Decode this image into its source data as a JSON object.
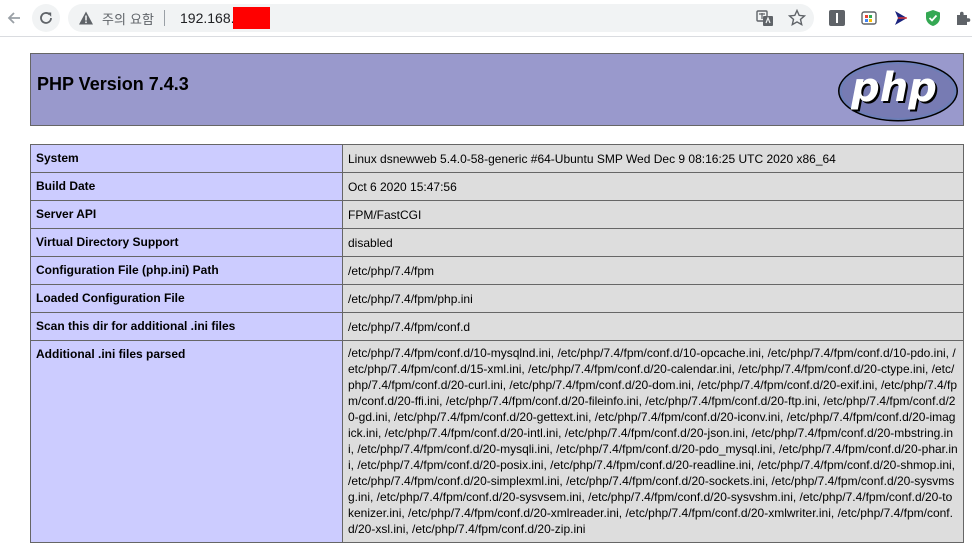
{
  "browser": {
    "security_label": "주의 요함",
    "url_text": "192.168.",
    "icons": [
      "back-arrow-icon",
      "reload-icon",
      "warning-triangle-icon",
      "translate-icon",
      "star-icon",
      "extension-icons",
      "puzzle-icon"
    ]
  },
  "page": {
    "title": "PHP Version 7.4.3",
    "logo_text": "php",
    "rows": [
      {
        "key": "System",
        "value": "Linux dsnewweb 5.4.0-58-generic #64-Ubuntu SMP Wed Dec 9 08:16:25 UTC 2020 x86_64"
      },
      {
        "key": "Build Date",
        "value": "Oct 6 2020 15:47:56"
      },
      {
        "key": "Server API",
        "value": "FPM/FastCGI"
      },
      {
        "key": "Virtual Directory Support",
        "value": "disabled"
      },
      {
        "key": "Configuration File (php.ini) Path",
        "value": "/etc/php/7.4/fpm"
      },
      {
        "key": "Loaded Configuration File",
        "value": "/etc/php/7.4/fpm/php.ini"
      },
      {
        "key": "Scan this dir for additional .ini files",
        "value": "/etc/php/7.4/fpm/conf.d"
      },
      {
        "key": "Additional .ini files parsed",
        "value": "/etc/php/7.4/fpm/conf.d/10-mysqlnd.ini, /etc/php/7.4/fpm/conf.d/10-opcache.ini, /etc/php/7.4/fpm/conf.d/10-pdo.ini, /etc/php/7.4/fpm/conf.d/15-xml.ini, /etc/php/7.4/fpm/conf.d/20-calendar.ini, /etc/php/7.4/fpm/conf.d/20-ctype.ini, /etc/php/7.4/fpm/conf.d/20-curl.ini, /etc/php/7.4/fpm/conf.d/20-dom.ini, /etc/php/7.4/fpm/conf.d/20-exif.ini, /etc/php/7.4/fpm/conf.d/20-ffi.ini, /etc/php/7.4/fpm/conf.d/20-fileinfo.ini, /etc/php/7.4/fpm/conf.d/20-ftp.ini, /etc/php/7.4/fpm/conf.d/20-gd.ini, /etc/php/7.4/fpm/conf.d/20-gettext.ini, /etc/php/7.4/fpm/conf.d/20-iconv.ini, /etc/php/7.4/fpm/conf.d/20-imagick.ini, /etc/php/7.4/fpm/conf.d/20-intl.ini, /etc/php/7.4/fpm/conf.d/20-json.ini, /etc/php/7.4/fpm/conf.d/20-mbstring.ini, /etc/php/7.4/fpm/conf.d/20-mysqli.ini, /etc/php/7.4/fpm/conf.d/20-pdo_mysql.ini, /etc/php/7.4/fpm/conf.d/20-phar.ini, /etc/php/7.4/fpm/conf.d/20-posix.ini, /etc/php/7.4/fpm/conf.d/20-readline.ini, /etc/php/7.4/fpm/conf.d/20-shmop.ini, /etc/php/7.4/fpm/conf.d/20-simplexml.ini, /etc/php/7.4/fpm/conf.d/20-sockets.ini, /etc/php/7.4/fpm/conf.d/20-sysvmsg.ini, /etc/php/7.4/fpm/conf.d/20-sysvsem.ini, /etc/php/7.4/fpm/conf.d/20-sysvshm.ini, /etc/php/7.4/fpm/conf.d/20-tokenizer.ini, /etc/php/7.4/fpm/conf.d/20-xmlreader.ini, /etc/php/7.4/fpm/conf.d/20-xmlwriter.ini, /etc/php/7.4/fpm/conf.d/20-xsl.ini, /etc/php/7.4/fpm/conf.d/20-zip.ini"
      }
    ]
  },
  "colors": {
    "header_bg": "#9999cc",
    "key_bg": "#ccccff",
    "value_bg": "#dddddd",
    "redaction": "#ff0000"
  }
}
